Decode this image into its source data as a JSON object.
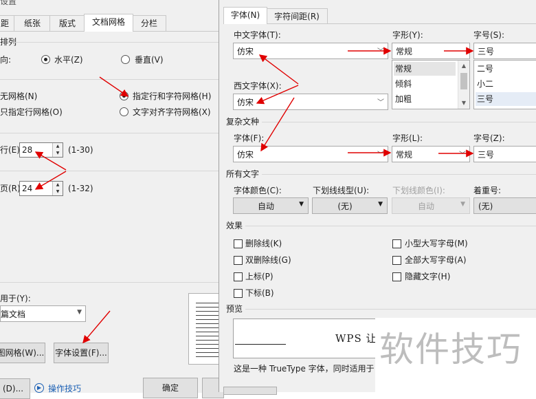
{
  "back_dialog": {
    "title": "设置",
    "tabs": [
      {
        "label": "距"
      },
      {
        "label": "纸张"
      },
      {
        "label": "版式"
      },
      {
        "label": "文档网格",
        "active": true
      },
      {
        "label": "分栏"
      }
    ],
    "orientation_section": "排列",
    "orientation_label": "向:",
    "horizontal_label": "水平(Z)",
    "vertical_label": "垂直(V)",
    "grid_options": {
      "no_grid": "无网格(N)",
      "lines_chars": "指定行和字符网格(H)",
      "lines_only": "只指定行网格(O)",
      "snap_chars": "文字对齐字符网格(X)"
    },
    "chars": {
      "label": "行(E):",
      "value": "28",
      "range": "(1-30)"
    },
    "lines": {
      "label": "页(R):",
      "value": "24",
      "range": "(1-32)"
    },
    "apply_to_label": "用于(Y):",
    "apply_to_value": "篇文档",
    "draw_grid_button": "图网格(W)...",
    "font_settings_button": "字体设置(F)...",
    "default_button": "(D)...",
    "tips_link": "操作技巧",
    "ok_button": "确定"
  },
  "font_dialog": {
    "tabs": [
      {
        "label": "字体(N)",
        "active": true
      },
      {
        "label": "字符间距(R)"
      }
    ],
    "chinese_font_label": "中文字体(T):",
    "chinese_font_value": "仿宋",
    "style_label": "字形(Y):",
    "style_value": "常规",
    "style_options": [
      "常规",
      "倾斜",
      "加粗"
    ],
    "size_label": "字号(S):",
    "size_value": "三号",
    "size_options": [
      "二号",
      "小二",
      "三号"
    ],
    "western_font_label": "西文字体(X):",
    "western_font_value": "仿宋",
    "complex_section": "复杂文种",
    "complex_font_label": "字体(F):",
    "complex_font_value": "仿宋",
    "complex_style_label": "字形(L):",
    "complex_style_value": "常规",
    "complex_size_label": "字号(Z):",
    "complex_size_value": "三号",
    "all_text_section": "所有文字",
    "font_color_label": "字体颜色(C):",
    "font_color_value": "自动",
    "underline_type_label": "下划线线型(U):",
    "underline_type_value": "(无)",
    "underline_color_label": "下划线颜色(I):",
    "underline_color_value": "自动",
    "emphasis_label": "着重号:",
    "emphasis_value": "(无)",
    "effects_section": "效果",
    "effects": {
      "strikethrough": "删除线(K)",
      "double_strikethrough": "双删除线(G)",
      "superscript": "上标(P)",
      "subscript": "下标(B)",
      "small_caps": "小型大写字母(M)",
      "all_caps": "全部大写字母(A)",
      "hidden": "隐藏文字(H)"
    },
    "preview_section": "预览",
    "preview_text": "WPS 让",
    "preview_note": "这是一种 TrueType 字体，同时适用于"
  },
  "watermark": "软件技巧",
  "colors": {
    "annotation_arrow": "#e00000",
    "dialog_bg": "#f0f0f0",
    "link": "#1a5fb4"
  }
}
